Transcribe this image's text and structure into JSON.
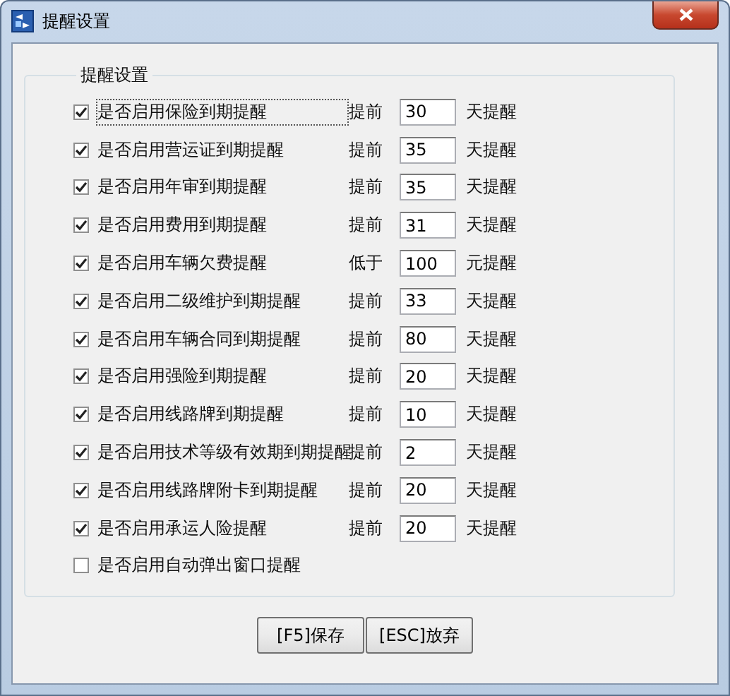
{
  "window": {
    "title": "提醒设置"
  },
  "group": {
    "title": "提醒设置",
    "rows": [
      {
        "kind": "threshold",
        "label": "是否启用保险到期提醒",
        "checked": true,
        "focused": true,
        "prefix": "提前",
        "value": "30",
        "suffix": "天提醒"
      },
      {
        "kind": "threshold",
        "label": "是否启用营运证到期提醒",
        "checked": true,
        "prefix": "提前",
        "value": "35",
        "suffix": "天提醒"
      },
      {
        "kind": "threshold",
        "label": "是否启用年审到期提醒",
        "checked": true,
        "prefix": "提前",
        "value": "35",
        "suffix": "天提醒"
      },
      {
        "kind": "threshold",
        "label": "是否启用费用到期提醒",
        "checked": true,
        "prefix": "提前",
        "value": "31",
        "suffix": "天提醒"
      },
      {
        "kind": "threshold",
        "label": "是否启用车辆欠费提醒",
        "checked": true,
        "prefix": "低于",
        "value": "100",
        "suffix": "元提醒"
      },
      {
        "kind": "threshold",
        "label": "是否启用二级维护到期提醒",
        "checked": true,
        "prefix": "提前",
        "value": "33",
        "suffix": "天提醒"
      },
      {
        "kind": "threshold",
        "label": "是否启用车辆合同到期提醒",
        "checked": true,
        "prefix": "提前",
        "value": "80",
        "suffix": "天提醒"
      },
      {
        "kind": "threshold",
        "label": "是否启用强险到期提醒",
        "checked": true,
        "prefix": "提前",
        "value": "20",
        "suffix": "天提醒"
      },
      {
        "kind": "threshold",
        "label": "是否启用线路牌到期提醒",
        "checked": true,
        "prefix": "提前",
        "value": "10",
        "suffix": "天提醒"
      },
      {
        "kind": "threshold",
        "label": "是否启用技术等级有效期到期提醒",
        "checked": true,
        "prefix": "提前",
        "value": "2",
        "suffix": "天提醒"
      },
      {
        "kind": "threshold",
        "label": "是否启用线路牌附卡到期提醒",
        "checked": true,
        "prefix": "提前",
        "value": "20",
        "suffix": "天提醒"
      },
      {
        "kind": "threshold",
        "label": "是否启用承运人险提醒",
        "checked": true,
        "prefix": "提前",
        "value": "20",
        "suffix": "天提醒"
      },
      {
        "kind": "toggle",
        "label": "是否启用自动弹出窗口提醒",
        "checked": false
      }
    ]
  },
  "buttons": [
    "[F5]保存",
    "[ESC]放弃"
  ]
}
